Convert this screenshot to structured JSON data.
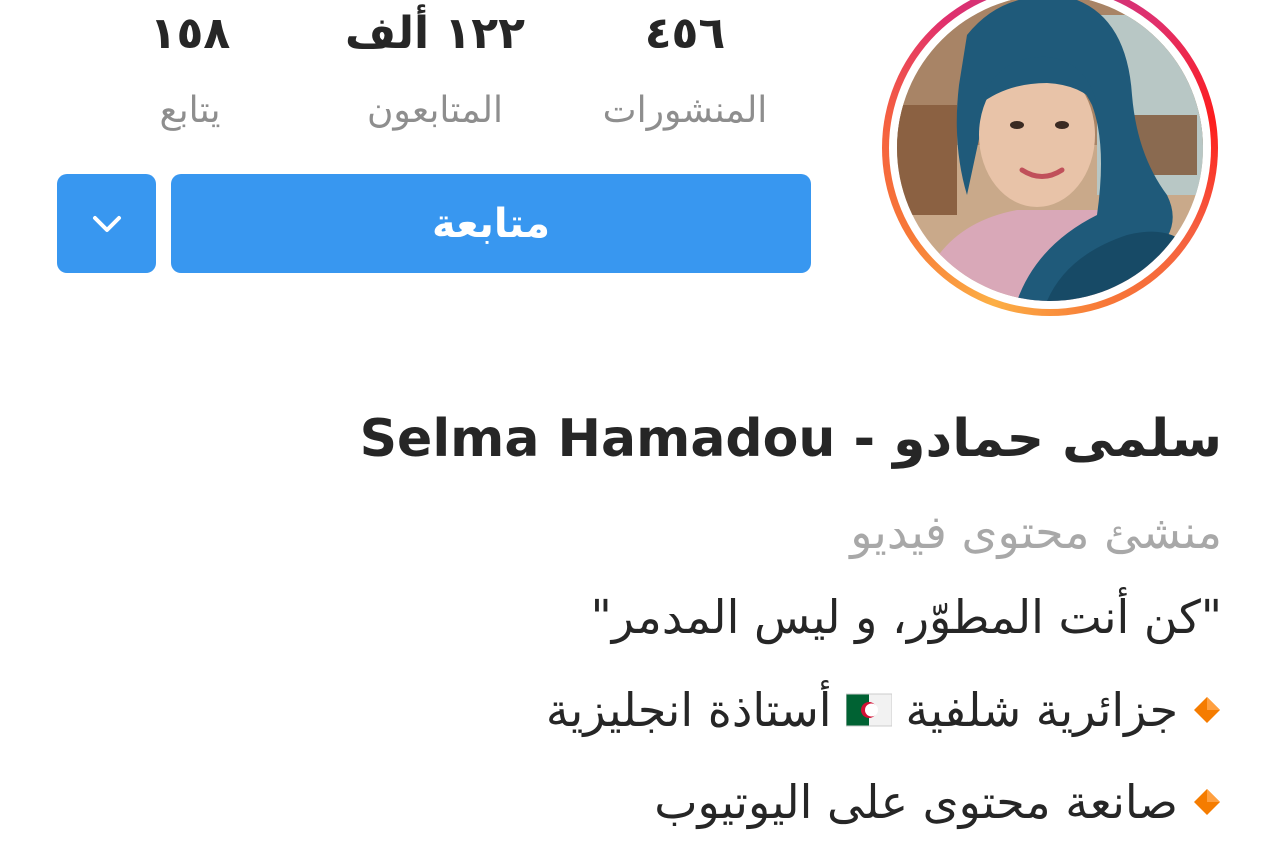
{
  "stats": {
    "following": {
      "value": "١٥٨",
      "label": "يتابع"
    },
    "followers": {
      "value": "١٢٢ ألف",
      "label": "المتابعون"
    },
    "posts": {
      "value": "٤٥٦",
      "label": "المنشورات"
    }
  },
  "actions": {
    "follow_label": "متابعة"
  },
  "profile": {
    "full_name": "سلمى حمادو - Selma Hamadou",
    "category": "منشئ محتوى فيديو",
    "bio": {
      "quote": "\"كن أنت المطوّر، و ليس المدمر\"",
      "line1_part1": "جزائرية شلفية",
      "line1_part2": "أستاذة انجليزية",
      "line2": "صانعة محتوى على اليوتيوب"
    }
  },
  "colors": {
    "button_blue": "#3897f0",
    "text_dark": "#262626",
    "text_gray": "#8e8e8e",
    "category_gray": "#a8a8a8",
    "diamond_orange": "#f57c00"
  },
  "icons": {
    "dropdown": "chevron-down-icon",
    "bullet": "orange-diamond-icon",
    "flag": "algeria-flag-icon"
  }
}
